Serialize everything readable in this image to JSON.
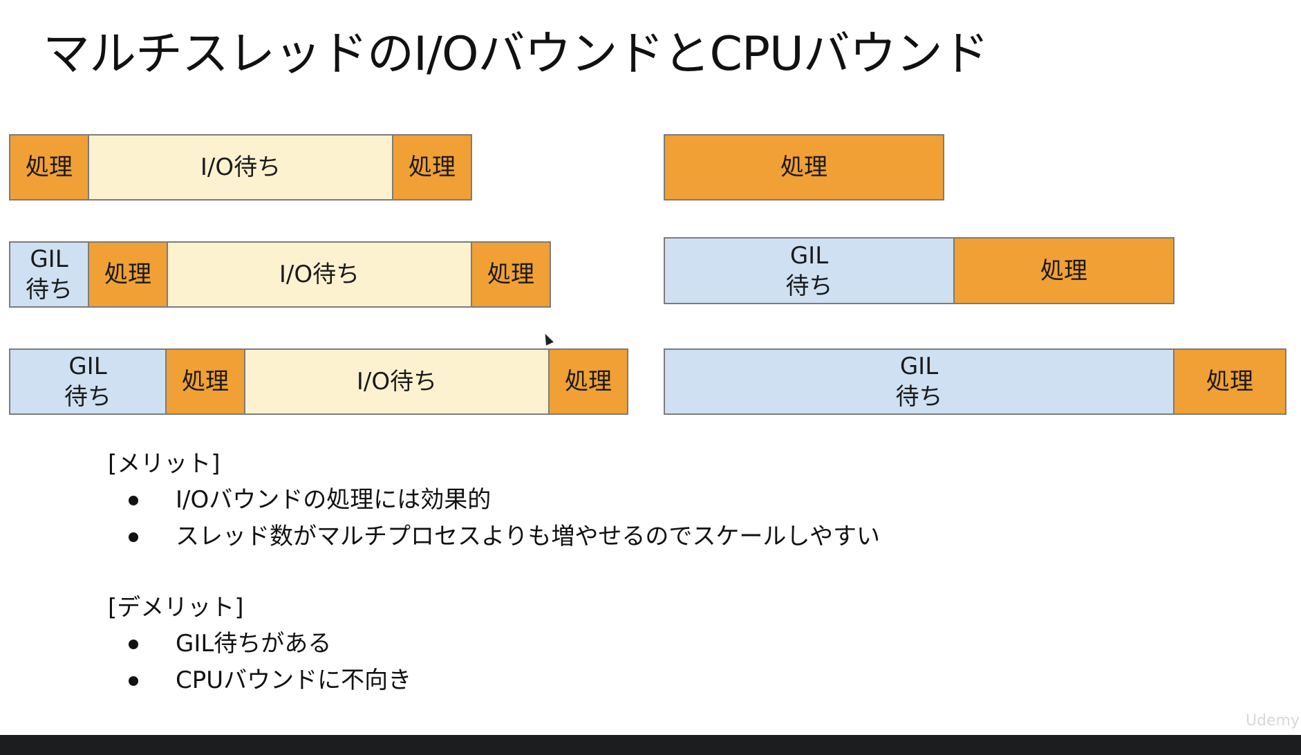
{
  "title": "マルチスレッドのI/OバウンドとCPUバウンド",
  "colors": {
    "processing": "#f0a035",
    "io_wait": "#fdf2d0",
    "gil_wait": "#cfe0f2",
    "border": "#7b7b7b"
  },
  "diagram": {
    "io_bound": {
      "row1": {
        "seg1": "処理",
        "seg2": "I/O待ち",
        "seg3": "処理"
      },
      "row2": {
        "seg1_line1": "GIL",
        "seg1_line2": "待ち",
        "seg2": "処理",
        "seg3": "I/O待ち",
        "seg4": "処理"
      },
      "row3": {
        "seg1_line1": "GIL",
        "seg1_line2": "待ち",
        "seg2": "処理",
        "seg3": "I/O待ち",
        "seg4": "処理"
      }
    },
    "cpu_bound": {
      "row1": {
        "seg1": "処理"
      },
      "row2": {
        "seg1_line1": "GIL",
        "seg1_line2": "待ち",
        "seg2": "処理"
      },
      "row3": {
        "seg1_line1": "GIL",
        "seg1_line2": "待ち",
        "seg2": "処理"
      }
    }
  },
  "merits": {
    "heading": "[メリット]",
    "items": [
      "I/Oバウンドの処理には効果的",
      "スレッド数がマルチプロセスよりも増やせるのでスケールしやすい"
    ]
  },
  "demerits": {
    "heading": "[デメリット]",
    "items": [
      "GIL待ちがある",
      "CPUバウンドに不向き"
    ]
  },
  "watermark": "Udemy"
}
